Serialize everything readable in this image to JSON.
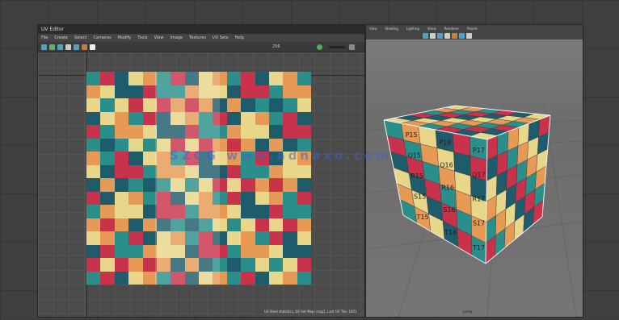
{
  "uv_editor": {
    "title": "UV Editor",
    "menu": [
      "File",
      "Create",
      "Select",
      "Cameras",
      "Modify",
      "Tools",
      "View",
      "Image",
      "Textures",
      "UV Sets",
      "Help"
    ],
    "toolbar_field": "256",
    "footer_text": "UV Shell statistics, UV Set Map: map1, Last UV Tile: 1001"
  },
  "viewport": {
    "menu": [
      "View",
      "Shading",
      "Lighting",
      "Show",
      "Renderer",
      "Panels"
    ],
    "footer_text": "persp"
  },
  "checker_colors": [
    "#2a8f8a",
    "#e8d68a",
    "#c8324a",
    "#e79a56",
    "#1e5c6b"
  ],
  "cube_labels": [
    "P15",
    "P16",
    "P17",
    "Q15",
    "Q16",
    "Q17",
    "R15",
    "R16",
    "R17",
    "S15",
    "S16",
    "S17",
    "T15",
    "T16",
    "T17"
  ],
  "watermark": "SZCG www.adnaxo.com"
}
